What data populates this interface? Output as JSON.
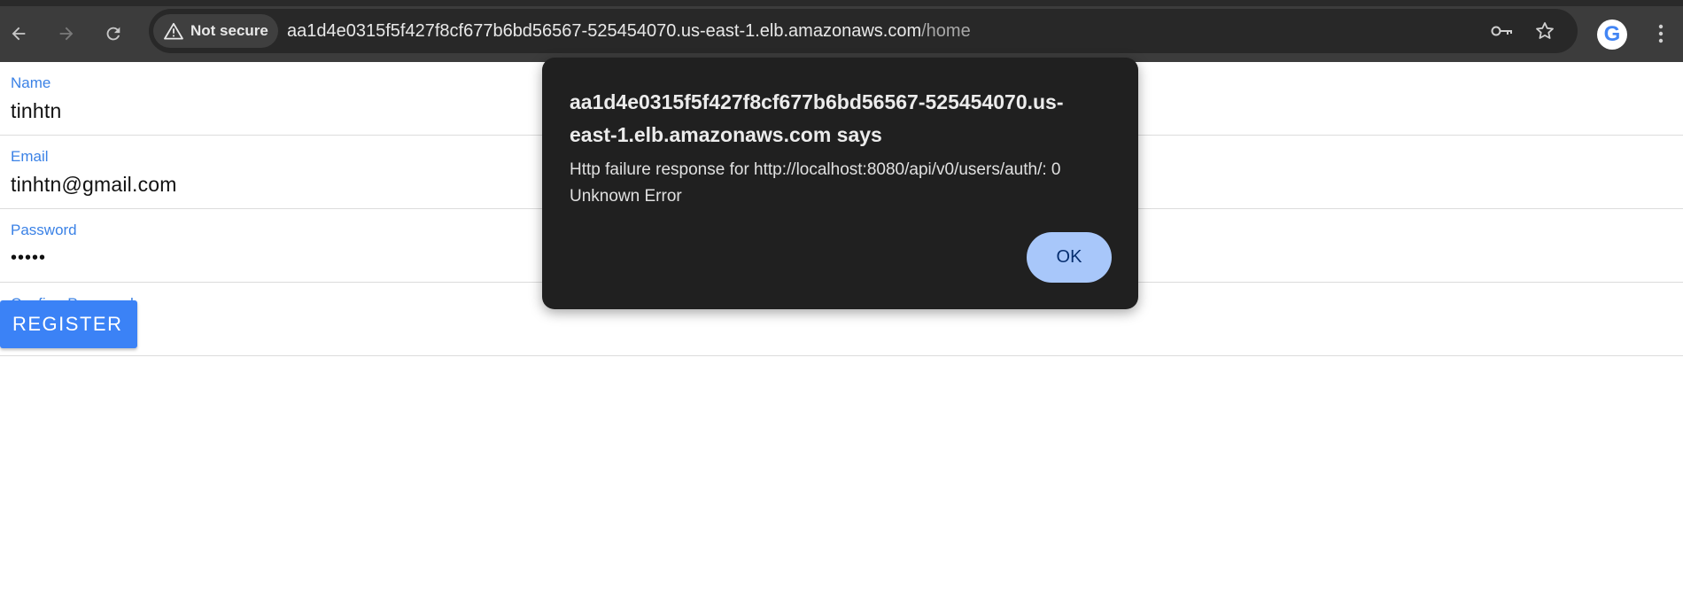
{
  "browser": {
    "security_label": "Not secure",
    "url_host": "aa1d4e0315f5f427f8cf677b6bd56567-525454070.us-east-1.elb.amazonaws.com",
    "url_path": "/home",
    "icons": {
      "back": "back-arrow-icon",
      "forward": "forward-arrow-icon",
      "reload": "reload-icon",
      "warning": "warning-icon",
      "key": "key-icon",
      "star": "star-icon",
      "profile": "google-icon",
      "menu": "more-vert-icon"
    },
    "profile_letter": "G"
  },
  "form": {
    "fields": [
      {
        "label": "Name",
        "value": "tinhtn"
      },
      {
        "label": "Email",
        "value": "tinhtn@gmail.com"
      },
      {
        "label": "Password",
        "value": "•••••"
      },
      {
        "label": "Confirm Password",
        "value": "•••••"
      }
    ],
    "register_label": "REGISTER"
  },
  "dialog": {
    "title": "aa1d4e0315f5f427f8cf677b6bd56567-525454070.us-east-1.elb.amazonaws.com says",
    "message": "Http failure response for http://localhost:8080/api/v0/users/auth/: 0 Unknown Error",
    "ok_label": "OK"
  },
  "colors": {
    "toolbar_bg": "#3c3c3c",
    "omnibox_bg": "#282828",
    "dialog_bg": "#202020",
    "ok_button": "#a8c7fa",
    "field_label": "#3b82e6",
    "register_button": "#3b82f6"
  }
}
